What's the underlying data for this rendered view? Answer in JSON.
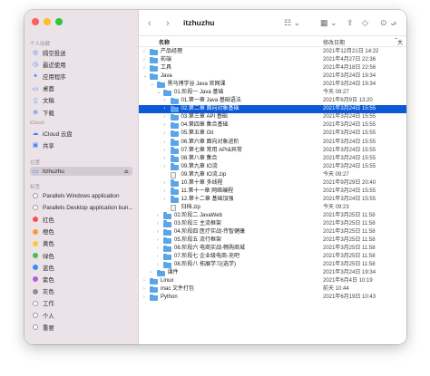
{
  "window": {
    "title": "itzhuzhu"
  },
  "sidebar": {
    "sections": {
      "favorites": "个人收藏",
      "icloud": "iCloud",
      "locations": "位置",
      "tags": "标签"
    },
    "favorites": [
      {
        "label": "隔空投送",
        "icon": "airdrop-icon",
        "glyph": "◎"
      },
      {
        "label": "最近使用",
        "icon": "clock-icon",
        "glyph": "◷"
      },
      {
        "label": "应用程序",
        "icon": "applications-icon",
        "glyph": "✦"
      },
      {
        "label": "桌面",
        "icon": "desktop-icon",
        "glyph": "▭"
      },
      {
        "label": "文稿",
        "icon": "document-icon",
        "glyph": "▯"
      },
      {
        "label": "下载",
        "icon": "download-icon",
        "glyph": "⊕"
      }
    ],
    "icloud": [
      {
        "label": "iCloud 云盘",
        "icon": "cloud-icon",
        "glyph": "☁"
      },
      {
        "label": "共享",
        "icon": "shared-folder-icon",
        "glyph": "▣"
      }
    ],
    "locations": [
      {
        "label": "itzhuzhu",
        "icon": "computer-icon",
        "glyph": "▭",
        "eject": "⏏"
      }
    ],
    "tags": [
      {
        "label": "Parallels Windows application",
        "color": "#ffffff"
      },
      {
        "label": "Parallels Desktop application bun...",
        "color": "#ffffff"
      },
      {
        "label": "红色",
        "color": "#ff4d4d"
      },
      {
        "label": "橙色",
        "color": "#ff9b2e"
      },
      {
        "label": "黄色",
        "color": "#f5cd2f"
      },
      {
        "label": "绿色",
        "color": "#47c04d"
      },
      {
        "label": "蓝色",
        "color": "#3c8cf5"
      },
      {
        "label": "紫色",
        "color": "#b160d6"
      },
      {
        "label": "灰色",
        "color": "#8e8e93"
      },
      {
        "label": "工作",
        "color": "#ffffff"
      },
      {
        "label": "个人",
        "color": "#ffffff"
      },
      {
        "label": "重要",
        "color": "#ffffff"
      }
    ]
  },
  "toolbar": {
    "back": "‹",
    "forward": "›",
    "view": "☷ ⌄",
    "group": "▦ ⌄",
    "share": "⇪",
    "tag": "◇",
    "more": "⊙ ⌄",
    "search": "⌕"
  },
  "columns": {
    "name": "名称",
    "date": "修改日期",
    "sort": "⌃",
    "size": "大"
  },
  "rows": [
    {
      "depth": 0,
      "disc": "›",
      "type": "folder",
      "name": "产品经理",
      "date": "2021年12月21日 14:22"
    },
    {
      "depth": 0,
      "disc": "›",
      "type": "folder",
      "name": "前端",
      "date": "2021年4月27日 22:36"
    },
    {
      "depth": 0,
      "disc": "›",
      "type": "folder",
      "name": "工具",
      "date": "2021年4月18日 22:56"
    },
    {
      "depth": 0,
      "disc": "⌄",
      "type": "folder",
      "name": "Java",
      "date": "2021年3月24日 19:34"
    },
    {
      "depth": 1,
      "disc": "⌄",
      "type": "folder",
      "name": "黑马博学谷 Java 官网课",
      "date": "2021年3月24日 19:34"
    },
    {
      "depth": 2,
      "disc": "⌄",
      "type": "folder",
      "name": "01.阶段一 Java 基础",
      "date": "今天 09:27"
    },
    {
      "depth": 3,
      "disc": "›",
      "type": "folder",
      "name": "01.第一章 Java 基础语法",
      "date": "2021年6月9日 13:20"
    },
    {
      "depth": 3,
      "disc": "›",
      "type": "folder",
      "name": "02.第二章 面向对象基础",
      "date": "2021年3月24日 15:55",
      "selected": true
    },
    {
      "depth": 3,
      "disc": "›",
      "type": "folder",
      "name": "03.第三章 API 基础",
      "date": "2021年3月24日 15:55"
    },
    {
      "depth": 3,
      "disc": "›",
      "type": "folder",
      "name": "04.第四章 集合基础",
      "date": "2021年3月24日 15:55"
    },
    {
      "depth": 3,
      "disc": "›",
      "type": "folder",
      "name": "05.第五章 Git",
      "date": "2021年3月24日 15:55"
    },
    {
      "depth": 3,
      "disc": "›",
      "type": "folder",
      "name": "06.第六章 面向对象进阶",
      "date": "2021年3月24日 15:55"
    },
    {
      "depth": 3,
      "disc": "›",
      "type": "folder",
      "name": "07.第七章 常用 API&异常",
      "date": "2021年3月24日 15:55"
    },
    {
      "depth": 3,
      "disc": "›",
      "type": "folder",
      "name": "08.第八章 集合",
      "date": "2021年3月24日 15:55"
    },
    {
      "depth": 3,
      "disc": "›",
      "type": "folder",
      "name": "09.第九章 IO流",
      "date": "2021年3月24日 15:55"
    },
    {
      "depth": 3,
      "disc": "",
      "type": "file",
      "name": "09.第九章 IO流.zip",
      "date": "今天 09:27"
    },
    {
      "depth": 3,
      "disc": "›",
      "type": "folder",
      "name": "10.第十章 多线程",
      "date": "2021年9月29日 20:40"
    },
    {
      "depth": 3,
      "disc": "›",
      "type": "folder",
      "name": "11.第十一章 网络编程",
      "date": "2021年3月24日 15:55"
    },
    {
      "depth": 3,
      "disc": "›",
      "type": "folder",
      "name": "12.第十二章 基础加强",
      "date": "2021年3月24日 15:55"
    },
    {
      "depth": 3,
      "disc": "",
      "type": "file",
      "name": "归档.zip",
      "date": "今天 09:23"
    },
    {
      "depth": 2,
      "disc": "›",
      "type": "folder",
      "name": "02.阶段二 JavaWeb",
      "date": "2021年3月25日 11:58"
    },
    {
      "depth": 2,
      "disc": "›",
      "type": "folder",
      "name": "03.阶段三 主流框架",
      "date": "2021年3月25日 11:58"
    },
    {
      "depth": 2,
      "disc": "›",
      "type": "folder",
      "name": "04.阶段四 医疗实战-传智健康",
      "date": "2021年3月25日 11:58"
    },
    {
      "depth": 2,
      "disc": "›",
      "type": "folder",
      "name": "05.阶段五 流行框架",
      "date": "2021年3月25日 11:58"
    },
    {
      "depth": 2,
      "disc": "›",
      "type": "folder",
      "name": "06.阶段六 电商实战-畅购商城",
      "date": "2021年3月25日 11:58"
    },
    {
      "depth": 2,
      "disc": "›",
      "type": "folder",
      "name": "07.阶段七 企业级电商-充吧",
      "date": "2021年3月25日 11:58"
    },
    {
      "depth": 2,
      "disc": "›",
      "type": "folder",
      "name": "08.阶段八 拓展学习(选学)",
      "date": "2021年3月25日 11:58"
    },
    {
      "depth": 1,
      "disc": "›",
      "type": "folder",
      "name": "课件",
      "date": "2021年3月24日 19:34"
    },
    {
      "depth": 0,
      "disc": "›",
      "type": "folder",
      "name": "Linux",
      "date": "2021年6月4日 10:19"
    },
    {
      "depth": 0,
      "disc": "›",
      "type": "folder",
      "name": "mac 文件打包",
      "date": "前天 10:44"
    },
    {
      "depth": 0,
      "disc": "›",
      "type": "folder",
      "name": "Python",
      "date": "2021年6月19日 10:43"
    }
  ]
}
